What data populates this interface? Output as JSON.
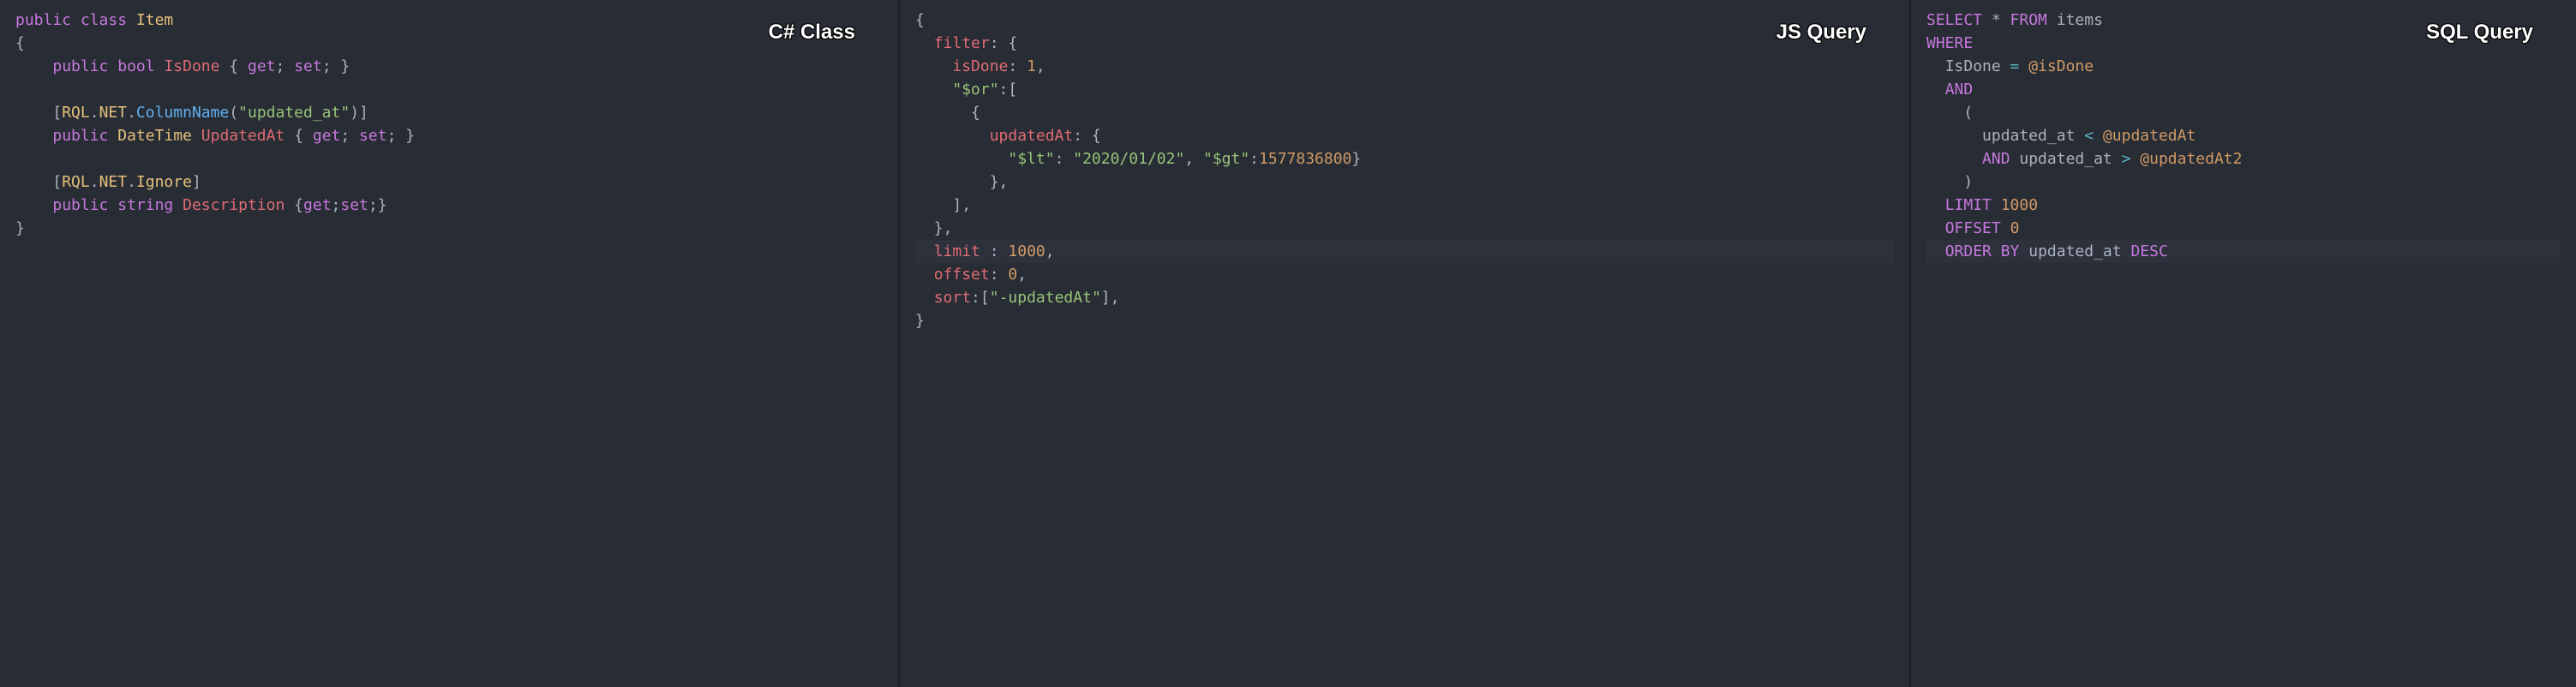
{
  "panels": {
    "csharp": {
      "title": "C# Class",
      "lines": {
        "l0a": "public",
        "l0b": "class",
        "l0c": "Item",
        "l1": "{",
        "l2a": "public",
        "l2b": "bool",
        "l2c": "IsDone",
        "l2d": " { ",
        "l2e": "get",
        "l2f": "; ",
        "l2g": "set",
        "l2h": "; }",
        "l3a": "[",
        "l3b": "RQL",
        "l3c": ".",
        "l3d": "NET",
        "l3e": ".",
        "l3f": "ColumnName",
        "l3g": "(",
        "l3h": "\"updated_at\"",
        "l3i": ")]",
        "l4a": "public",
        "l4b": "DateTime",
        "l4c": "UpdatedAt",
        "l4d": " { ",
        "l4e": "get",
        "l4f": "; ",
        "l4g": "set",
        "l4h": "; }",
        "l5a": "[",
        "l5b": "RQL",
        "l5c": ".",
        "l5d": "NET",
        "l5e": ".",
        "l5f": "Ignore",
        "l5g": "]",
        "l6a": "public",
        "l6b": "string",
        "l6c": "Description",
        "l6d": " {",
        "l6e": "get",
        "l6f": ";",
        "l6g": "set",
        "l6h": ";}",
        "l7": "}"
      }
    },
    "js": {
      "title": "JS Query",
      "lines": {
        "l0": "{",
        "l1a": "filter",
        "l1b": ": {",
        "l2a": "isDone",
        "l2b": ": ",
        "l2c": "1",
        "l2d": ",",
        "l3a": "\"$or\"",
        "l3b": ":[",
        "l4": "{",
        "l5a": "updatedAt",
        "l5b": ": {",
        "l6a": "\"$lt\"",
        "l6b": ": ",
        "l6c": "\"2020/01/02\"",
        "l6d": ", ",
        "l6e": "\"$gt\"",
        "l6f": ":",
        "l6g": "1577836800",
        "l6h": "}",
        "l7": "},",
        "l8": "],",
        "l9": "},",
        "l10a": "limit",
        "l10b": " : ",
        "l10c": "1000",
        "l10d": ",",
        "l11a": "offset",
        "l11b": ": ",
        "l11c": "0",
        "l11d": ",",
        "l12a": "sort",
        "l12b": ":[",
        "l12c": "\"-updatedAt\"",
        "l12d": "],",
        "l13": "}"
      }
    },
    "sql": {
      "title": "SQL Query",
      "lines": {
        "l0a": "SELECT",
        "l0b": " * ",
        "l0c": "FROM",
        "l0d": " items",
        "l1": "WHERE",
        "l2a": "IsDone ",
        "l2b": "=",
        "l2c": " @isDone",
        "l3": "AND",
        "l4": "(",
        "l5a": "updated_at ",
        "l5b": "<",
        "l5c": " @updatedAt",
        "l6a": "AND",
        "l6b": " updated_at ",
        "l6c": ">",
        "l6d": " @updatedAt2",
        "l7": ")",
        "l8a": "LIMIT",
        "l8b": " ",
        "l8c": "1000",
        "l9a": "OFFSET",
        "l9b": " ",
        "l9c": "0",
        "l10a": "ORDER BY",
        "l10b": " updated_at ",
        "l10c": "DESC"
      }
    }
  }
}
